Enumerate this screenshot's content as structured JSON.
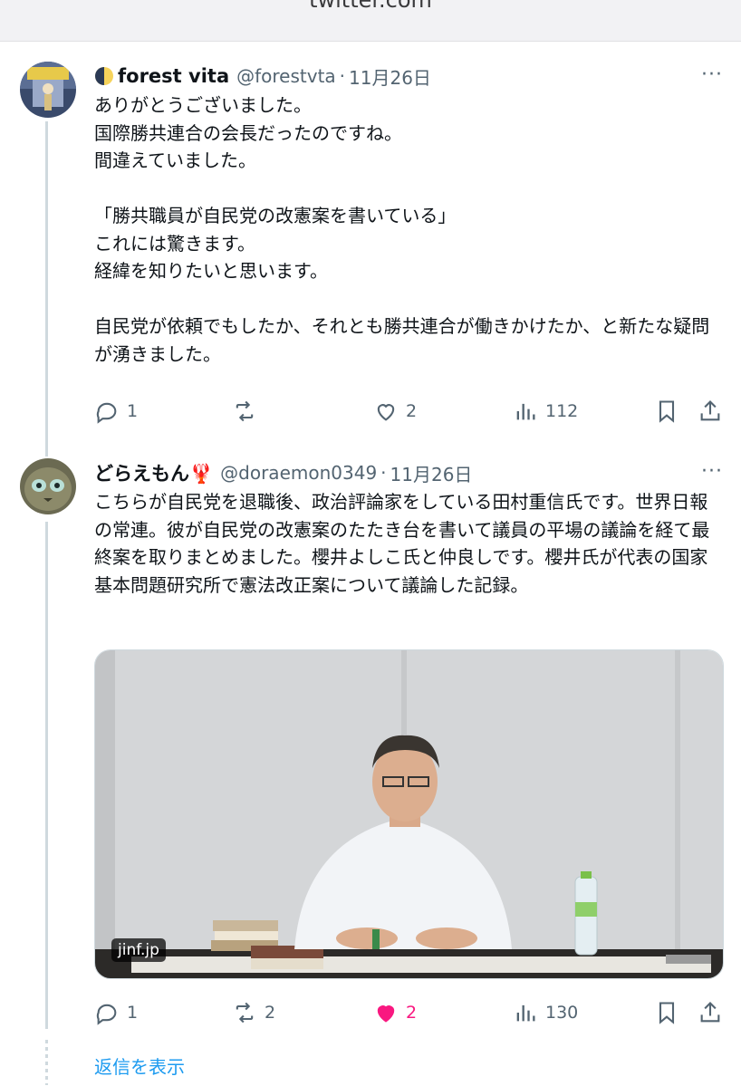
{
  "browser": {
    "url": "twitter.com"
  },
  "tweets": [
    {
      "display_name": "forest vita",
      "handle": "@forestvta",
      "separator": "·",
      "date": "11月26日",
      "more": "···",
      "text": "ありがとうございました。\n国際勝共連合の会長だったのですね。\n間違えていました。\n\n「勝共職員が自民党の改憲案を書いている」\nこれには驚きます。\n経緯を知りたいと思います。\n\n自民党が依頼でもしたか、それとも勝共連合が働きかけたか、と新たな疑問が湧きました。",
      "stats": {
        "replies": "1",
        "retweets": "",
        "likes": "2",
        "views": "112"
      }
    },
    {
      "display_name": "どらえもん🦞",
      "handle": "@doraemon0349",
      "separator": "·",
      "date": "11月26日",
      "more": "···",
      "text": "こちらが自民党を退職後、政治評論家をしている田村重信氏です。世界日報の常連。彼が自民党の改憲案のたたき台を書いて議員の平場の議論を経て最終案を取りまとめました。櫻井よしこ氏と仲良しです。櫻井氏が代表の国家基本問題研究所で憲法改正案について議論した記録。",
      "media_badge": "jinf.jp",
      "stats": {
        "replies": "1",
        "retweets": "2",
        "likes": "2",
        "views": "130"
      },
      "liked": true
    }
  ],
  "show_replies": "返信を表示",
  "colors": {
    "accent": "#1d9bf0",
    "like": "#f91880",
    "muted": "#536471",
    "thread_line": "#cfd9de"
  },
  "icons": [
    "reply-icon",
    "retweet-icon",
    "like-icon",
    "views-icon",
    "bookmark-icon",
    "share-icon",
    "more-icon"
  ]
}
